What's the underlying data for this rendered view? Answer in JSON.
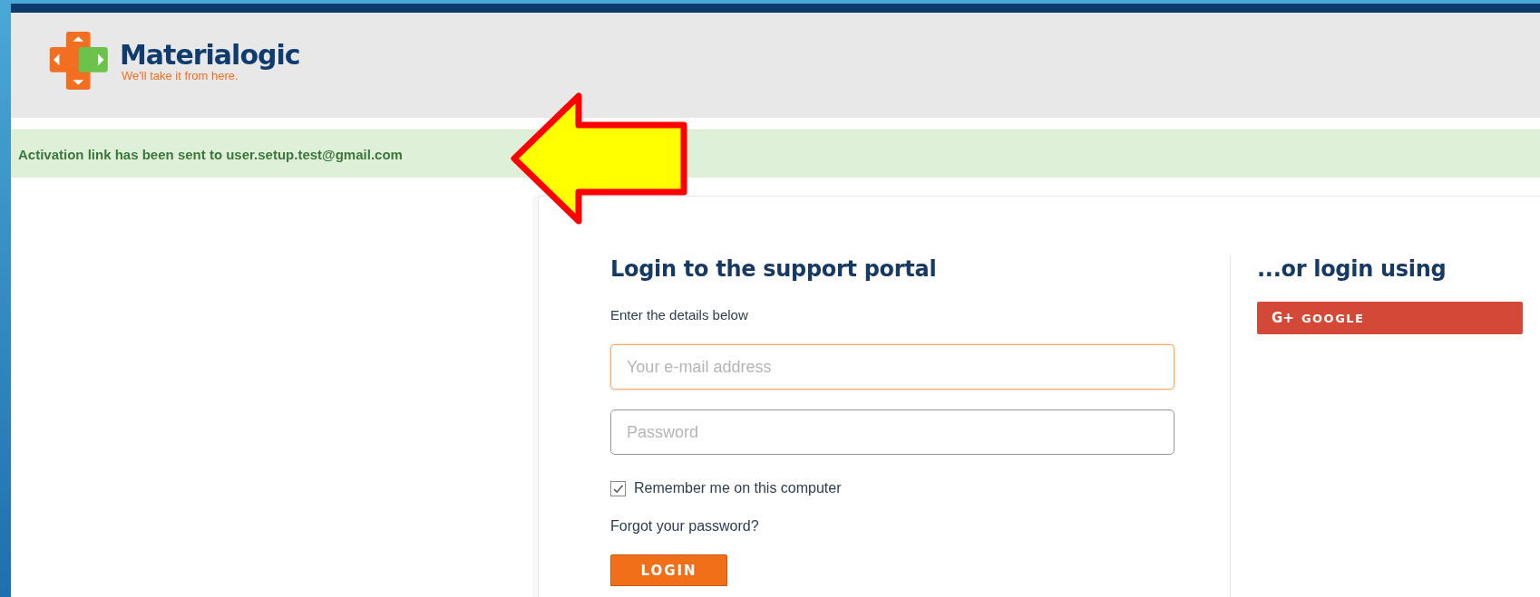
{
  "brand": {
    "name": "Materialogic",
    "tagline": "We'll take it from here."
  },
  "alert": {
    "message": "Activation link has been sent to user.setup.test@gmail.com"
  },
  "login_form": {
    "title": "Login to the support portal",
    "subtitle": "Enter the details below",
    "fields": [
      {
        "placeholder": "Your e-mail address",
        "focused": true
      },
      {
        "placeholder": "Password",
        "focused": false
      }
    ],
    "remember": {
      "label": "Remember me on this computer",
      "checked": true
    },
    "forgot_link": "Forgot your password?",
    "submit": "LOGIN"
  },
  "social_login": {
    "title": "...or login using",
    "buttons": [
      {
        "icon": "G+",
        "label": "GOOGLE",
        "color": "#d34836"
      }
    ]
  }
}
